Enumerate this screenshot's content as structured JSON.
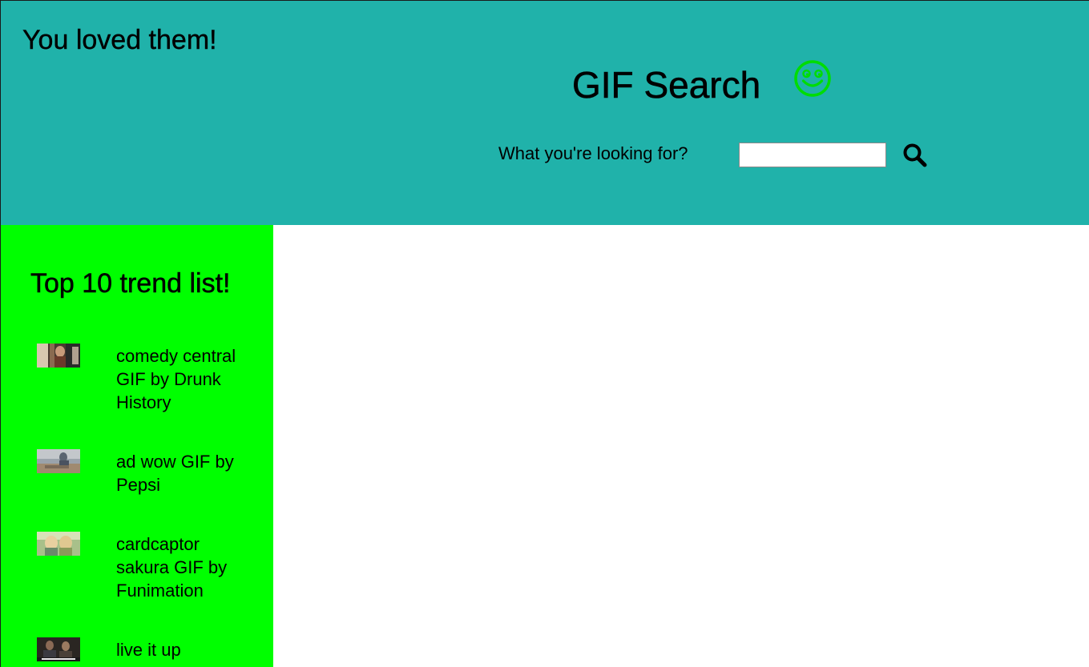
{
  "header": {
    "loved_title": "You loved them!",
    "site_title": "GIF Search",
    "search_label": "What you're looking for?",
    "search_value": "",
    "search_placeholder": "",
    "smiley_icon": "smiley-face-icon",
    "search_icon": "magnifier-icon",
    "background_color": "#20b2aa",
    "smiley_color": "#00dd00"
  },
  "sidebar": {
    "title": "Top 10 trend list!",
    "background_color": "#00ff00",
    "items": [
      {
        "label": "comedy central GIF by Drunk History"
      },
      {
        "label": "ad wow GIF by Pepsi"
      },
      {
        "label": "cardcaptor sakura GIF by Funimation"
      },
      {
        "label": "live it up"
      }
    ]
  }
}
